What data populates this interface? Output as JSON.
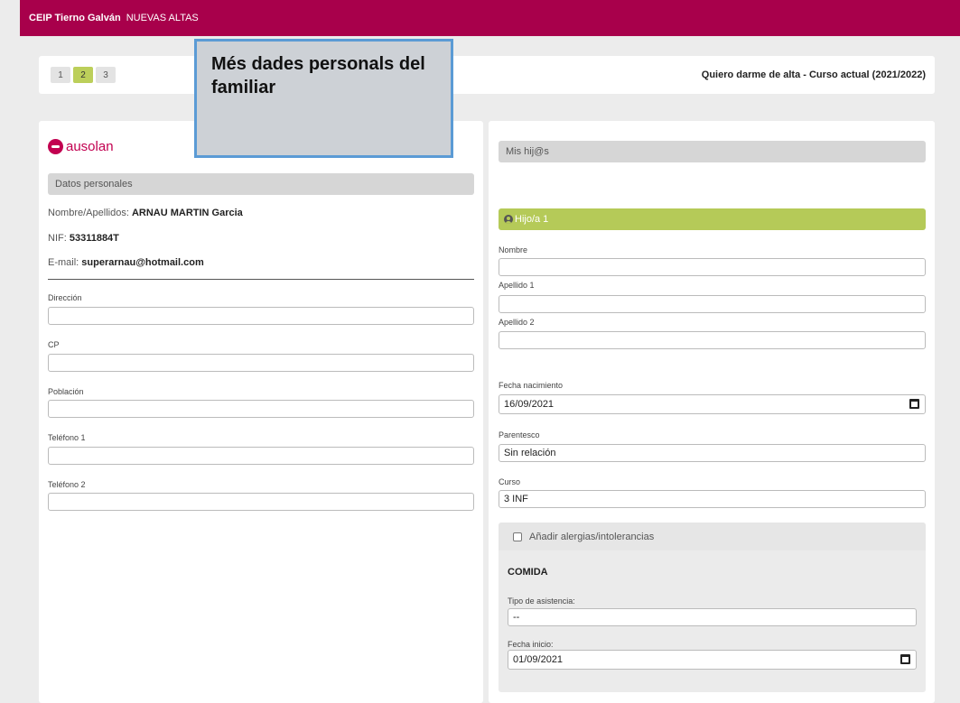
{
  "header": {
    "school": "CEIP Tierno Galván",
    "section": "NUEVAS ALTAS"
  },
  "steps": {
    "items": [
      "1",
      "2",
      "3"
    ],
    "active": "2"
  },
  "page_title": "Quiero darme de alta - Curso actual (2021/2022)",
  "callout": "Més dades personals del familiar",
  "left": {
    "logo_text": "ausolan",
    "section_title": "Datos personales",
    "name_label": "Nombre/Apellidos:",
    "name_value": "ARNAU MARTIN Garcia",
    "nif_label": "NIF:",
    "nif_value": "53311884T",
    "email_label": "E-mail:",
    "email_value": "superarnau@hotmail.com",
    "fields": {
      "direccion": {
        "label": "Dirección",
        "value": ""
      },
      "cp": {
        "label": "CP",
        "value": ""
      },
      "poblacion": {
        "label": "Población",
        "value": ""
      },
      "telefono1": {
        "label": "Teléfono 1",
        "value": ""
      },
      "telefono2": {
        "label": "Teléfono 2",
        "value": ""
      }
    }
  },
  "right": {
    "section_title": "Mis hij@s",
    "child_title": "Hijo/a 1",
    "fields": {
      "nombre": {
        "label": "Nombre",
        "value": ""
      },
      "apellido1": {
        "label": "Apellido 1",
        "value": ""
      },
      "apellido2": {
        "label": "Apellido 2",
        "value": ""
      },
      "fecha_nacimiento": {
        "label": "Fecha nacimiento",
        "value": "16/09/2021"
      },
      "parentesco": {
        "label": "Parentesco",
        "value": "Sin relación"
      },
      "curso": {
        "label": "Curso",
        "value": "3 INF"
      }
    },
    "allergies_label": "Añadir alergias/intolerancias",
    "comida": {
      "title": "COMIDA",
      "tipo_label": "Tipo de asistencia:",
      "tipo_value": "--",
      "fecha_label": "Fecha inicio:",
      "fecha_value": "01/09/2021"
    }
  },
  "icons": {
    "calendar": "calendar-icon",
    "user": "user-circle-icon",
    "logo": "ausolan-logo"
  },
  "colors": {
    "brand": "#a8004b",
    "accent": "#b5ca58",
    "callout_border": "#5b9bd5"
  }
}
